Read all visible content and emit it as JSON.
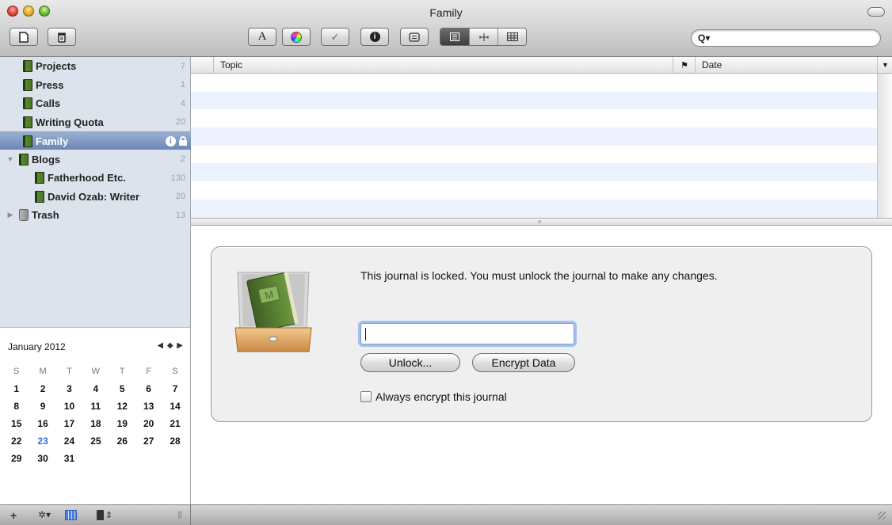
{
  "window": {
    "title": "Family"
  },
  "toolbar": {
    "new_glyph": "D",
    "delete_glyph": "🗑",
    "font_glyph": "A",
    "check_glyph": "✓",
    "info_glyph": "i",
    "search": {
      "value": "",
      "placeholder": "",
      "icon_glyph": "Q▾"
    }
  },
  "sidebar": {
    "items": [
      {
        "label": "Projects",
        "count": "7",
        "icon": "journal-icon"
      },
      {
        "label": "Press",
        "count": "1",
        "icon": "journal-icon"
      },
      {
        "label": "Calls",
        "count": "4",
        "icon": "journal-icon"
      },
      {
        "label": "Writing Quota",
        "count": "20",
        "icon": "journal-icon"
      },
      {
        "label": "Family",
        "count": "",
        "icon": "journal-icon",
        "selected": true,
        "locked": true
      },
      {
        "label": "Blogs",
        "count": "2",
        "icon": "journal-icon",
        "expanded": true
      },
      {
        "label": "Fatherhood Etc.",
        "count": "130",
        "icon": "journal-icon",
        "child": true
      },
      {
        "label": "David Ozab: Writer",
        "count": "20",
        "icon": "journal-icon",
        "child": true
      },
      {
        "label": "Trash",
        "count": "13",
        "icon": "trash-icon"
      }
    ]
  },
  "calendar": {
    "month_label": "January 2012",
    "nav": "◀ ◆ ▶",
    "weekdays": [
      "S",
      "M",
      "T",
      "W",
      "T",
      "F",
      "S"
    ],
    "weeks": [
      [
        "1",
        "2",
        "3",
        "4",
        "5",
        "6",
        "7"
      ],
      [
        "8",
        "9",
        "10",
        "11",
        "12",
        "13",
        "14"
      ],
      [
        "15",
        "16",
        "17",
        "18",
        "19",
        "20",
        "21"
      ],
      [
        "22",
        "23",
        "24",
        "25",
        "26",
        "27",
        "28"
      ],
      [
        "29",
        "30",
        "31",
        "",
        "",
        "",
        ""
      ]
    ],
    "today": "23",
    "today_color": "#2f6fe0"
  },
  "bottom_bar": {
    "add_glyph": "+",
    "gear_glyph": "✲▾",
    "sort_glyph": "⇕"
  },
  "table": {
    "columns": [
      "Topic",
      "Date"
    ],
    "flag_glyph": "⚑",
    "sort_arrow": "▼"
  },
  "lock_panel": {
    "message": "This journal is locked. You must unlock the journal to make any changes.",
    "password_value": "",
    "unlock_label": "Unlock...",
    "encrypt_label": "Encrypt Data",
    "always_encrypt_label": "Always encrypt this journal",
    "always_encrypt_checked": false
  },
  "colors": {
    "selection": "#6c87b5",
    "sidebar_bg": "#dde3ec",
    "row_stripe": "#edf3fe",
    "focus_ring": "#9fc0f0"
  }
}
